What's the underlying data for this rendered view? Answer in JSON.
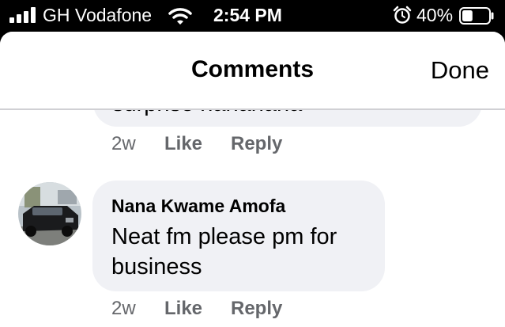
{
  "status_bar": {
    "carrier": "GH Vodafone",
    "time": "2:54 PM",
    "battery_percent": "40%",
    "battery_level": 0.4,
    "icons": [
      "signal-icon",
      "wifi-icon",
      "alarm-icon",
      "battery-icon"
    ]
  },
  "header": {
    "title": "Comments",
    "done_label": "Done"
  },
  "comments": [
    {
      "author": "",
      "text": "surprise hahahaha",
      "time": "2w",
      "like_label": "Like",
      "reply_label": "Reply"
    },
    {
      "author": "Nana Kwame Amofa",
      "text": "Neat fm please pm for business",
      "time": "2w",
      "like_label": "Like",
      "reply_label": "Reply"
    }
  ],
  "colors": {
    "status_bar_bg": "#000000",
    "sheet_bg": "#ffffff",
    "bubble_bg": "#f0f1f5",
    "meta_text": "#65676b",
    "divider": "#d0d0d4"
  }
}
